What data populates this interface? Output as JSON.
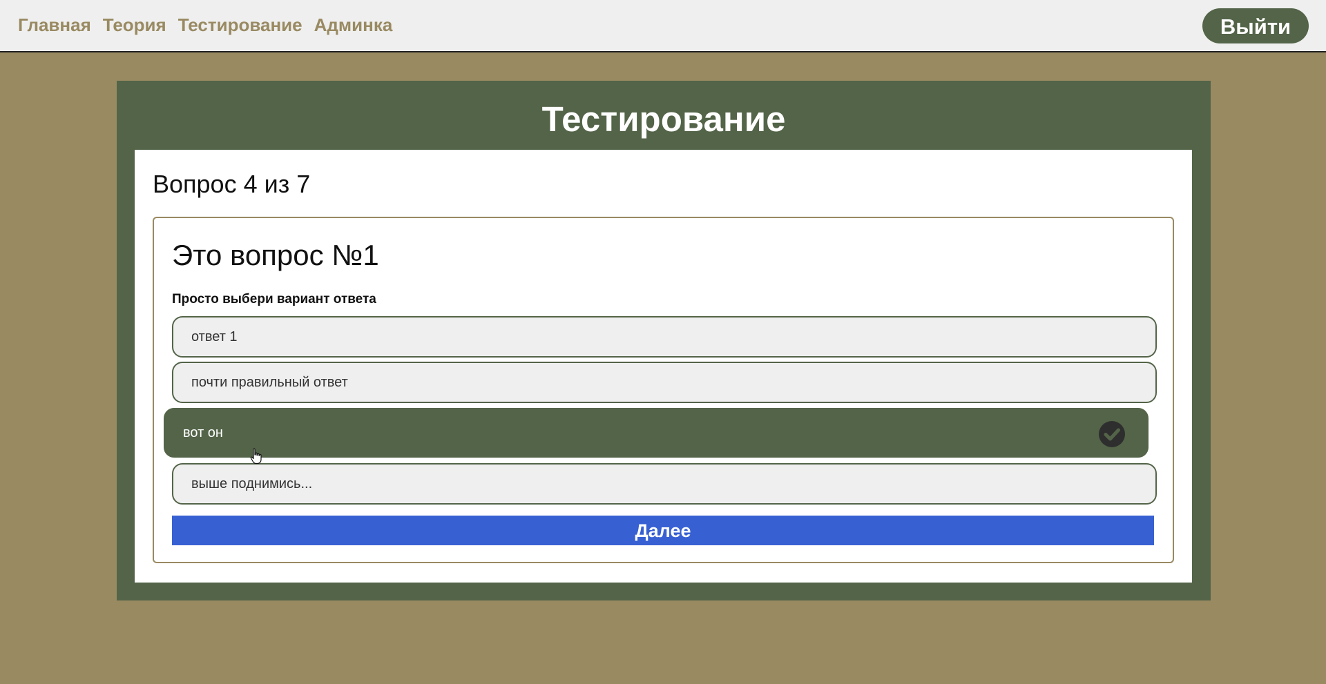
{
  "nav": {
    "items": [
      "Главная",
      "Теория",
      "Тестирование",
      "Админка"
    ],
    "logout_label": "Выйти"
  },
  "panel": {
    "title": "Тестирование",
    "counter": "Вопрос 4 из 7"
  },
  "question": {
    "title": "Это вопрос №1",
    "hint": "Просто выбери вариант ответа",
    "options": [
      {
        "label": "ответ 1",
        "selected": false
      },
      {
        "label": "почти правильный ответ",
        "selected": false
      },
      {
        "label": "вот он",
        "selected": true
      },
      {
        "label": "выше поднимись...",
        "selected": false
      }
    ],
    "next_label": "Далее"
  },
  "colors": {
    "page_bg": "#998a62",
    "panel_bg": "#536448",
    "nav_text": "#998a62",
    "button_blue": "#3760d2",
    "option_bg": "#efefef"
  },
  "icons": {
    "selected_option": "check-circle-icon",
    "pointer": "hand-cursor-icon"
  }
}
